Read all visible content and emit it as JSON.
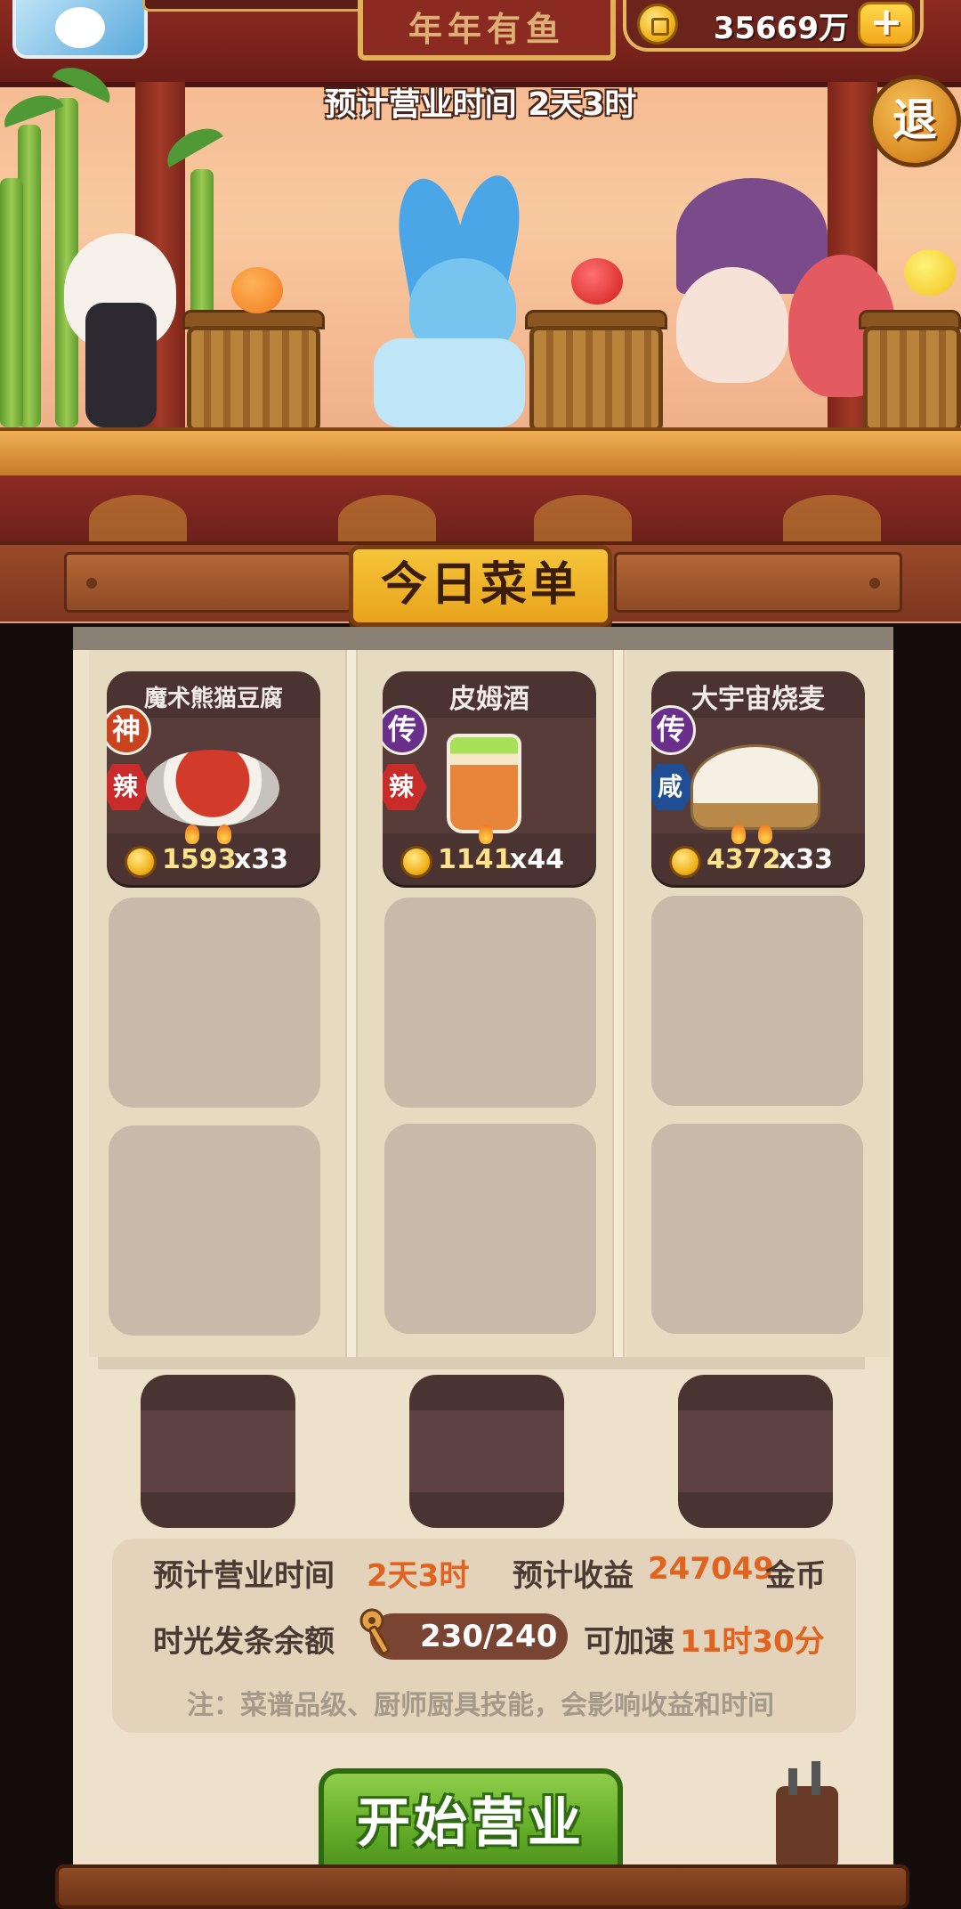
{
  "header": {
    "sign_text": "年年有鱼",
    "coins": "35669万",
    "add_coins_label": "+",
    "estimated_time_banner": "预计营业时间  2天3时",
    "exit_label": "退"
  },
  "menu": {
    "title": "今日菜单",
    "dishes": [
      {
        "name": "魔术熊猫豆腐",
        "rarity": "神",
        "rarity_color": "#c9431e",
        "flavor": "辣",
        "flavor_color": "#c92a2a",
        "price": "1593",
        "qty": "x33",
        "food_icon": "mapo-tofu-icon"
      },
      {
        "name": "皮姆酒",
        "rarity": "传",
        "rarity_color": "#6a2f8a",
        "flavor": "辣",
        "flavor_color": "#c92a2a",
        "price": "1141",
        "qty": "x44",
        "food_icon": "pimms-drink-icon"
      },
      {
        "name": "大宇宙烧麦",
        "rarity": "传",
        "rarity_color": "#6a2f8a",
        "flavor": "咸",
        "flavor_color": "#1f4e94",
        "price": "4372",
        "qty": "x33",
        "food_icon": "shaomai-icon"
      }
    ]
  },
  "info": {
    "time_label": "预计营业时间",
    "time_value": "2天3时",
    "income_label": "预计收益",
    "income_value": "247049",
    "income_unit": "金币",
    "balance_label": "时光发条余额",
    "balance_value": "230/240",
    "speedup_label": "可加速",
    "speedup_value": "11时30分",
    "note": "注：菜谱品级、厨师厨具技能，会影响收益和时间"
  },
  "actions": {
    "start_label": "开始营业"
  }
}
